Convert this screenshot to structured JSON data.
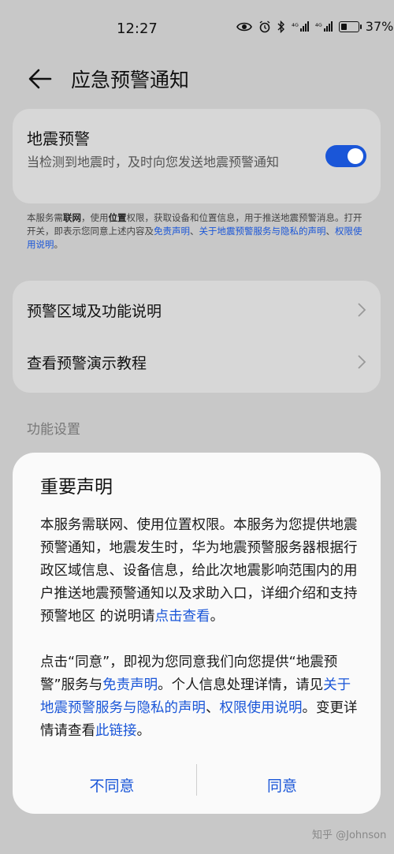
{
  "status": {
    "time": "12:27",
    "battery": "37%",
    "signal1": "⁴ᴳ",
    "signal2": "⁴ᴳ"
  },
  "header": {
    "title": "应急预警通知"
  },
  "quake_card": {
    "title": "地震预警",
    "desc": "当检测到地震时，及时向您发送地震预警通知",
    "toggle_on": true,
    "accent": "#1a56d8"
  },
  "notice": {
    "t1": "本服务需",
    "b1": "联网",
    "t2": "，使用",
    "b2": "位置",
    "t3": "权限，获取设备和位置信息，用于推送地震预警消息。打开开关，即表示您同意上述内容及",
    "l1": "免责声明",
    "t4": "、",
    "l2": "关于地震预警服务与隐私的声明",
    "t5": "、",
    "l3": "权限使用说明",
    "t6": "。"
  },
  "menu": {
    "item1": "预警区域及功能说明",
    "item2": "查看预警演示教程"
  },
  "section": {
    "label": "功能设置"
  },
  "dialog": {
    "title": "重要声明",
    "p1_text": "本服务需联网、使用位置权限。本服务为您提供地震预警通知，地震发生时，华为地震预警服务器根据行政区域信息、设备信息，给此次地震影响范围内的用户推送地震预警通知以及求助入口，详细介绍和支持预警地区 的说明请",
    "p1_link": "点击查看",
    "p1_end": "。",
    "p2_a": "点击“同意”，即视为您同意我们向您提供“地震预警”服务与",
    "p2_l1": "免责声明",
    "p2_b": "。个人信息处理详情，请见",
    "p2_l2": "关于地震预警服务与隐私的声明",
    "p2_c": "、",
    "p2_l3": "权限使用说明",
    "p2_d": "。变更详情请查看",
    "p2_l4": "此链接",
    "p2_e": "。",
    "disagree": "不同意",
    "agree": "同意"
  },
  "watermark": "知乎 @Johnson"
}
